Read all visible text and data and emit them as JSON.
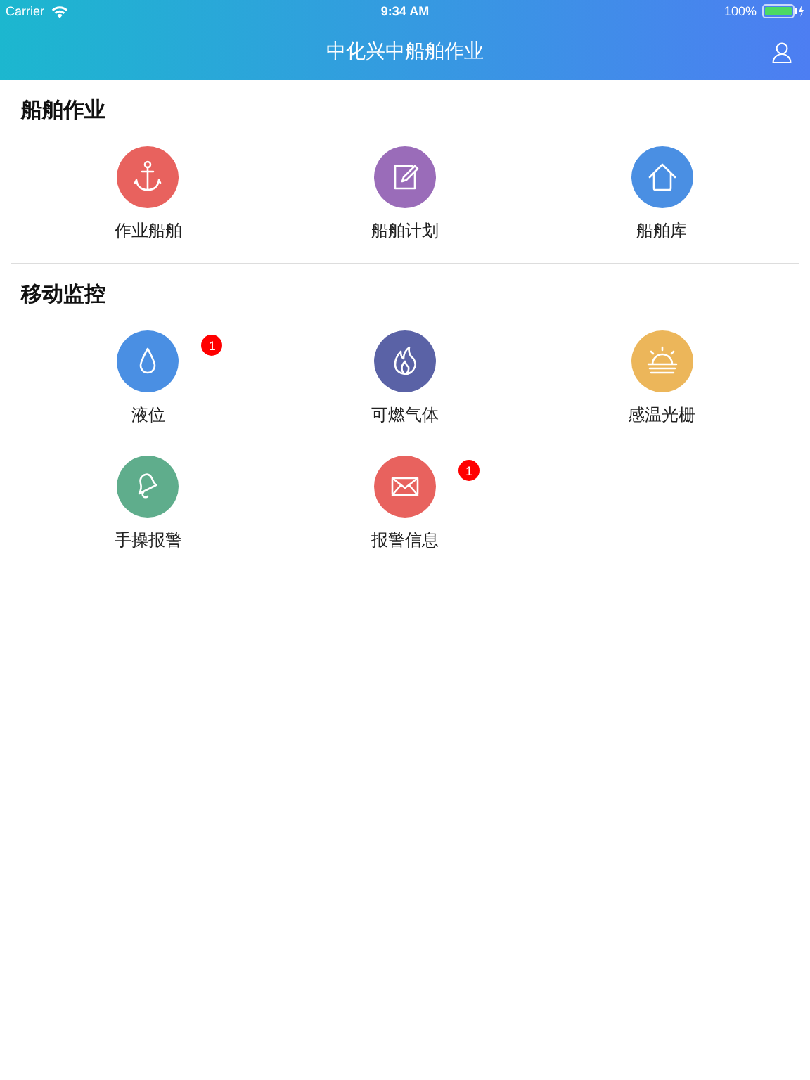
{
  "status_bar": {
    "carrier": "Carrier",
    "time": "9:34 AM",
    "battery": "100%"
  },
  "nav_bar": {
    "title": "中化兴中船舶作业"
  },
  "sections": [
    {
      "title": "船舶作业",
      "items": [
        {
          "label": "作业船舶",
          "kind": "anchor",
          "color": "#e8625e"
        },
        {
          "label": "船舶计划",
          "kind": "edit",
          "color": "#9a6cb9"
        },
        {
          "label": "船舶库",
          "kind": "house",
          "color": "#4a8fe3"
        }
      ]
    },
    {
      "title": "移动监控",
      "items": [
        {
          "label": "液位",
          "kind": "drop",
          "color": "#4a8fe3",
          "badge": "1"
        },
        {
          "label": "可燃气体",
          "kind": "flame",
          "color": "#5a62a6"
        },
        {
          "label": "感温光栅",
          "kind": "sunrise",
          "color": "#ecb65a"
        },
        {
          "label": "手操报警",
          "kind": "bell",
          "color": "#5fad8c"
        },
        {
          "label": "报警信息",
          "kind": "mail",
          "color": "#e8625e",
          "badge": "1"
        }
      ]
    }
  ]
}
